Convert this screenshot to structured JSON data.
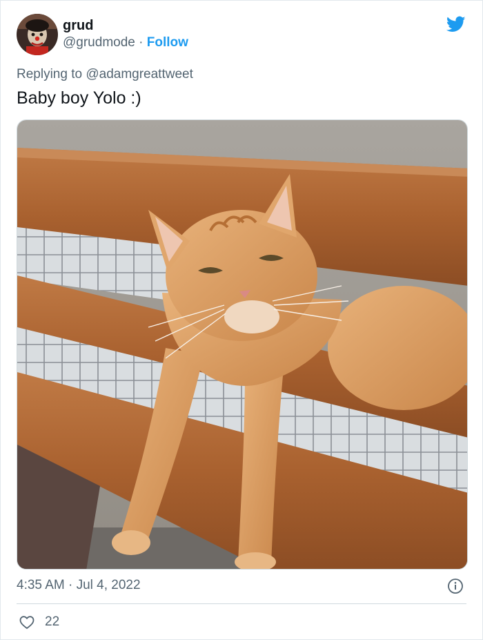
{
  "author": {
    "display_name": "grud",
    "handle": "@grudmode",
    "separator": "·",
    "follow_label": "Follow"
  },
  "reply": {
    "prefix": "Replying to",
    "mention": "@adamgreattweet"
  },
  "tweet": {
    "text": "Baby boy Yolo :)"
  },
  "footer": {
    "time": "4:35 AM",
    "separator": "·",
    "date": "Jul 4, 2022"
  },
  "engagement": {
    "like_count": "22"
  },
  "icons": {
    "brand": "twitter-bird-icon",
    "info": "info-icon",
    "like": "heart-icon"
  },
  "colors": {
    "accent": "#1d9bf0",
    "text_primary": "#0f1419",
    "text_secondary": "#536471",
    "border": "#cfd9de"
  }
}
